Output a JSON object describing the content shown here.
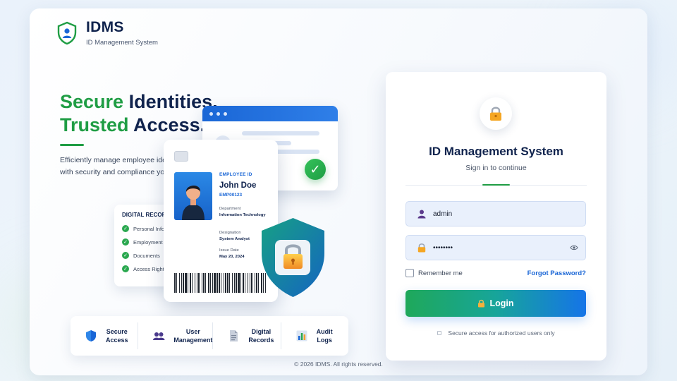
{
  "brand": {
    "title": "IDMS",
    "subtitle": "ID Management System",
    "logo_icon": "shield-user-icon"
  },
  "hero": {
    "line1_accent": "Secure",
    "line1_rest": "Identities.",
    "line2_accent": "Trusted",
    "line2_rest": "Access.",
    "description_line1": "Efficiently manage employee ide",
    "description_line2": "with security and compliance yo"
  },
  "records_card": {
    "title": "DIGITAL RECORD",
    "items": [
      {
        "label": "Personal Info"
      },
      {
        "label": "Employment"
      },
      {
        "label": "Documents"
      },
      {
        "label": "Access Rights"
      }
    ]
  },
  "id_card": {
    "header": "EMPLOYEE ID",
    "name": "John Doe",
    "employee_id": "EMP00123",
    "department_label": "Department",
    "department_value": "Information Technology",
    "designation_label": "Designation",
    "designation_value": "System Analyst",
    "issue_label": "Issue Date",
    "issue_value": "May 20, 2024"
  },
  "features": [
    {
      "icon": "shield-icon",
      "label": "Secure\nAccess"
    },
    {
      "icon": "users-icon",
      "label": "User\nManagement"
    },
    {
      "icon": "document-icon",
      "label": "Digital\nRecords"
    },
    {
      "icon": "bar-chart-icon",
      "label": "Audit\nLogs"
    }
  ],
  "login": {
    "title": "ID Management System",
    "subtitle": "Sign in to continue",
    "username_value": "admin",
    "password_value": "••••••••",
    "remember_label": "Remember me",
    "forgot_label": "Forgot Password?",
    "login_label": "Login",
    "secure_note": "Secure access for authorized users only"
  },
  "footer": {
    "copyright": "© 2026 IDMS. All rights reserved."
  },
  "colors": {
    "navy": "#10234d",
    "green": "#1f9d44",
    "blue": "#1a66d6",
    "field_bg": "#e9f0fc"
  }
}
